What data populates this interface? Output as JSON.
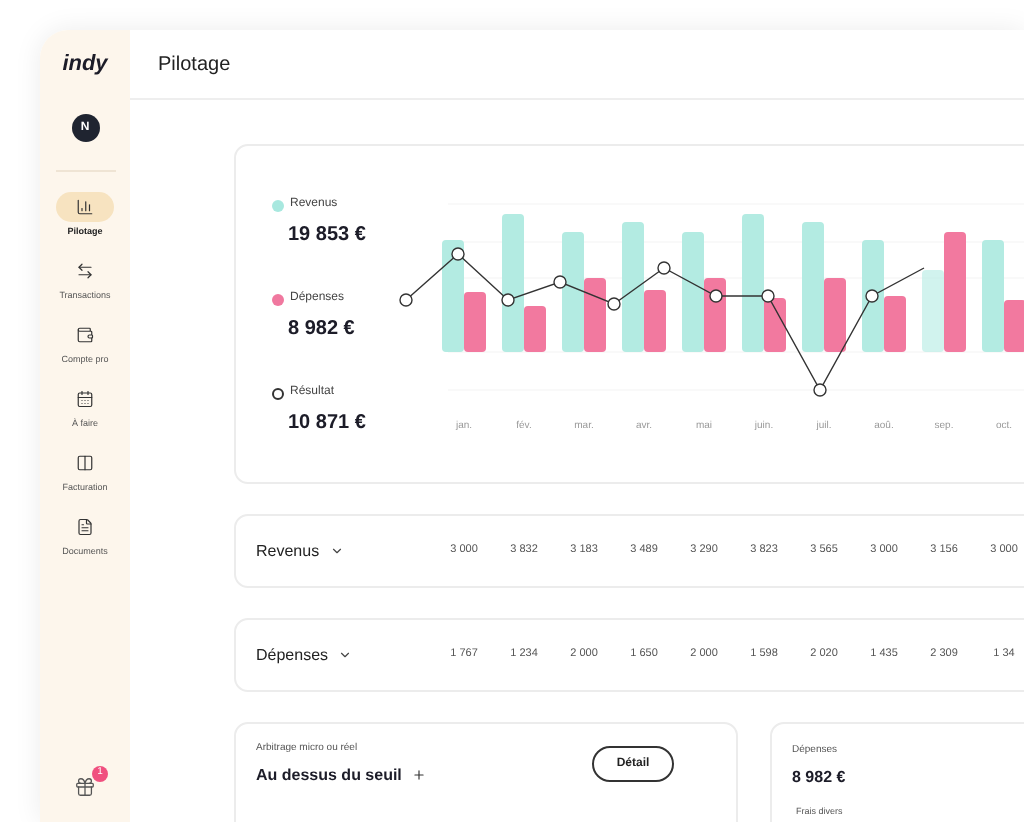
{
  "sidebar": {
    "logo": "indy",
    "avatar": "N",
    "items": [
      {
        "label": "Pilotage",
        "selected": true
      },
      {
        "label": "Transactions",
        "selected": false
      },
      {
        "label": "Compte pro",
        "selected": false
      },
      {
        "label": "À faire",
        "selected": false
      },
      {
        "label": "Facturation",
        "selected": false
      },
      {
        "label": "Documents",
        "selected": false
      }
    ],
    "gift_badge": "1"
  },
  "header": {
    "title": "Pilotage"
  },
  "chart_card": {
    "legend": [
      {
        "kind": "revenus",
        "label": "Revenus",
        "value": "19 853 €"
      },
      {
        "kind": "depenses",
        "label": "Dépenses",
        "value": "8 982 €"
      },
      {
        "kind": "resultat",
        "label": "Résultat",
        "value": "10 871 €"
      }
    ],
    "months": [
      "jan.",
      "fév.",
      "mar.",
      "avr.",
      "mai",
      "juin.",
      "juil.",
      "aoû.",
      "sep.",
      "oct."
    ]
  },
  "rows": [
    {
      "label": "Revenus",
      "values": [
        "3 000",
        "3 832",
        "3 183",
        "3 489",
        "3 290",
        "3 823",
        "3 565",
        "3 000",
        "3 156",
        "3 000"
      ]
    },
    {
      "label": "Dépenses",
      "values": [
        "1 767",
        "1 234",
        "2 000",
        "1 650",
        "2 000",
        "1 598",
        "2 020",
        "1 435",
        "2 309",
        "1 34"
      ]
    }
  ],
  "regime_card": {
    "caption": "Arbitrage micro ou réel",
    "value": "Au dessus du seuil",
    "button": "Détail"
  },
  "expenses_card": {
    "caption": "Dépenses",
    "value": "8 982 €",
    "item": "Frais divers"
  }
}
